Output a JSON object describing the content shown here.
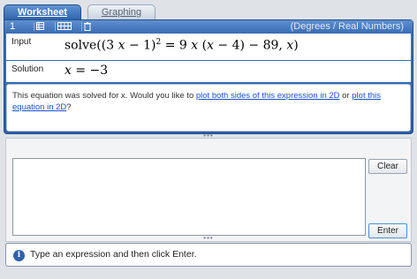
{
  "tabs": {
    "worksheet_label": "Worksheet",
    "graphing_label": "Graphing"
  },
  "worksheet": {
    "entry_number": "1",
    "mode_label": "(Degrees / Real Numbers)",
    "input_label": "Input",
    "solution_label": "Solution",
    "input_expression": {
      "func": "solve",
      "open": "((",
      "three": "3",
      "x1": "x",
      "minus_one": " − 1)",
      "squared": "2",
      "equals": " = 9",
      "x2": "x",
      "paren_open": " (",
      "x3": "x",
      "minus_four": " − 4) − 89,",
      "x4": "x",
      "close": ")"
    },
    "solution_expression": {
      "var": "x",
      "rest": " = −3"
    },
    "message": {
      "prefix": "This equation was solved for x. Would you like to ",
      "link1": "plot both sides of this expression in 2D",
      "middle": " or ",
      "link2": "plot this equation in 2D",
      "suffix": "?"
    }
  },
  "input_panel": {
    "input_value": "",
    "clear_label": "Clear",
    "enter_label": "Enter"
  },
  "status": {
    "info_icon_glyph": "i",
    "text": "Type an expression and then click Enter."
  },
  "colors": {
    "accent": "#2f62ab",
    "link": "#1a4fd6"
  }
}
